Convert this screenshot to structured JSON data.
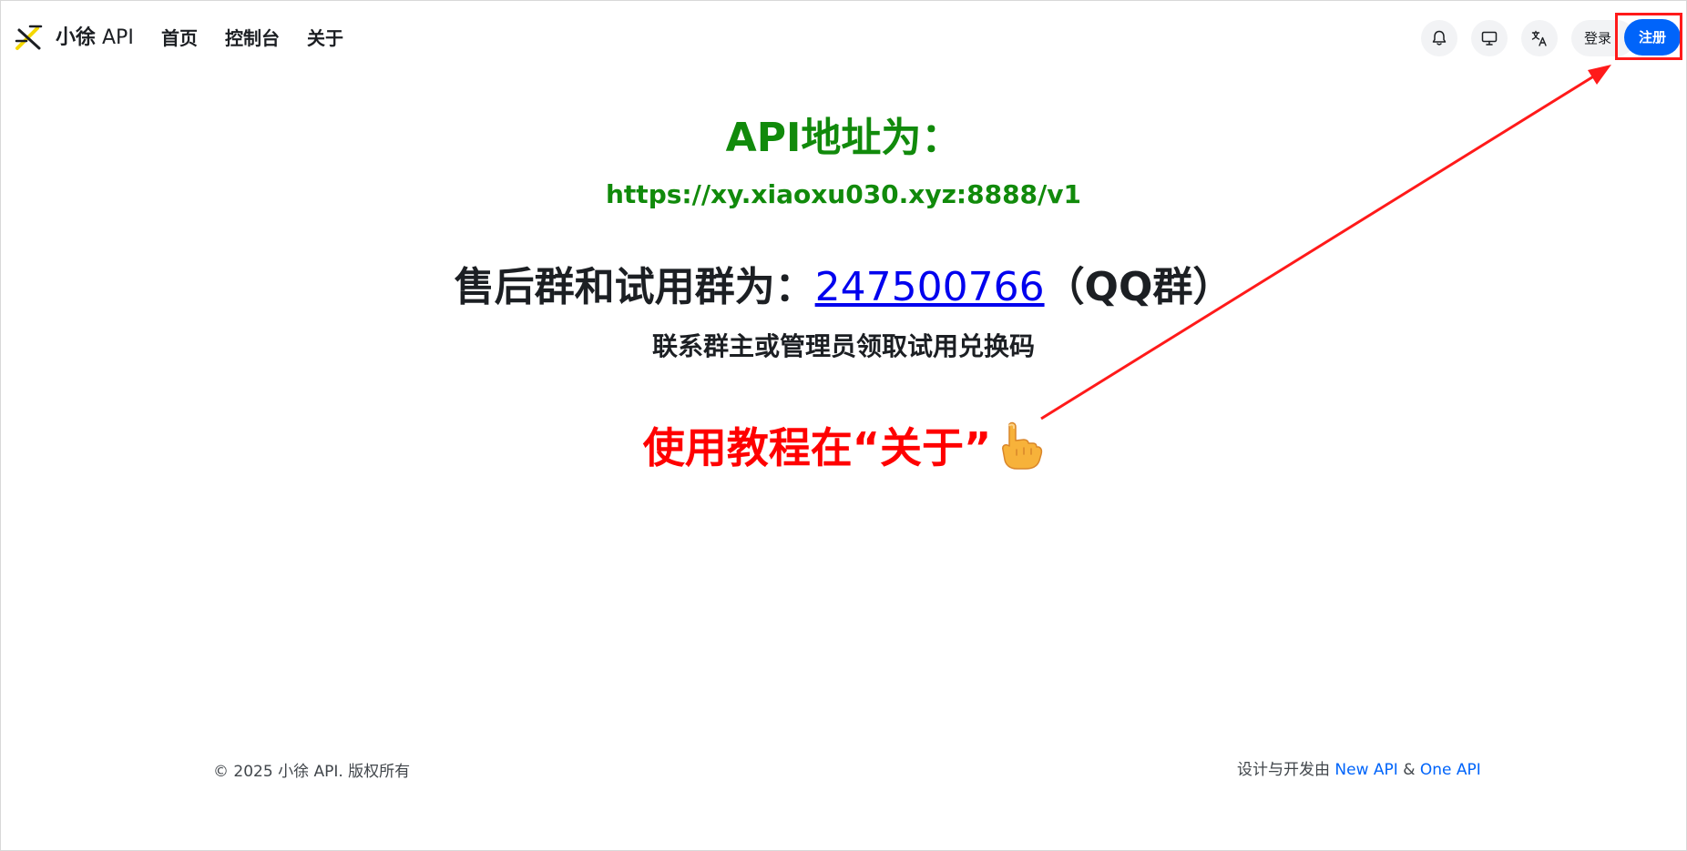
{
  "header": {
    "brand_prefix": "小徐",
    "brand_suffix": " API",
    "nav": [
      "首页",
      "控制台",
      "关于"
    ],
    "icons": [
      "bell-icon",
      "monitor-icon",
      "translate-icon"
    ],
    "login_label": "登录",
    "register_label": "注册"
  },
  "main": {
    "api_title": "API地址为：",
    "api_url": "https://xy.xiaoxu030.xyz:8888/v1",
    "group_prefix": "售后群和试用群为：",
    "group_number": "247500766",
    "group_suffix": "（QQ群）",
    "contact_text": "联系群主或管理员领取试用兑换码",
    "tutorial_text": "使用教程在“关于”",
    "tutorial_icon": "pointing-hand-icon"
  },
  "footer": {
    "copyright": "© 2025 小徐 API. 版权所有",
    "credits_prefix": "设计与开发由 ",
    "link_new_api": "New API",
    "amp": " & ",
    "link_one_api": "One API"
  },
  "colors": {
    "primary": "#0064fa",
    "api_green": "#118a0b",
    "annotation_red": "#ff1a1a",
    "link_blue": "#0000ee"
  }
}
